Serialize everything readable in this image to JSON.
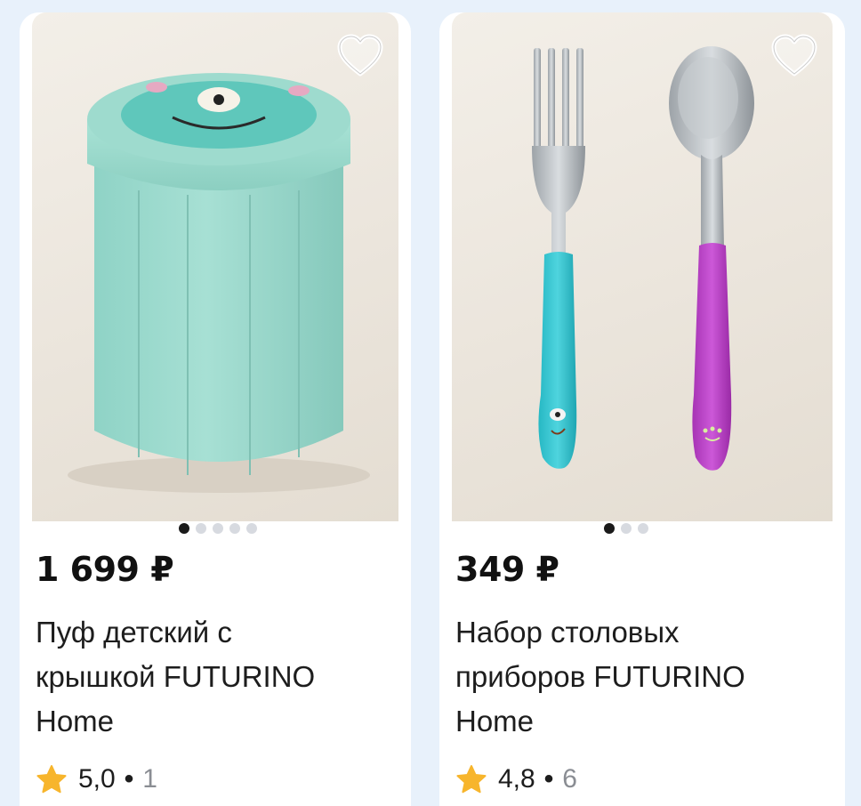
{
  "products": [
    {
      "image_alt": "Mint round storage pouf with monster face lid",
      "dots_total": 5,
      "dots_active": 0,
      "price": "1 699 ₽",
      "title_lines": [
        "Пуф детский с",
        "крышкой FUTURINO",
        "Home"
      ],
      "rating": "5,0",
      "separator": "•",
      "reviews": "1"
    },
    {
      "image_alt": "Kids fork and spoon with turquoise and purple handles",
      "dots_total": 3,
      "dots_active": 0,
      "price": "349 ₽",
      "title_lines": [
        "Набор столовых",
        "приборов FUTURINO",
        "Home"
      ],
      "rating": "4,8",
      "separator": "•",
      "reviews": "6"
    }
  ],
  "icons": {
    "favorite": "heart-outline-icon",
    "rating": "star-icon"
  },
  "colors": {
    "page_background": "#e8f1fb",
    "card_background": "#ffffff",
    "star": "#f7b52c",
    "price_text": "#111111",
    "muted_text": "#8a8d93",
    "dot_active": "#1a1a1a",
    "dot_inactive": "#d7dae0"
  }
}
